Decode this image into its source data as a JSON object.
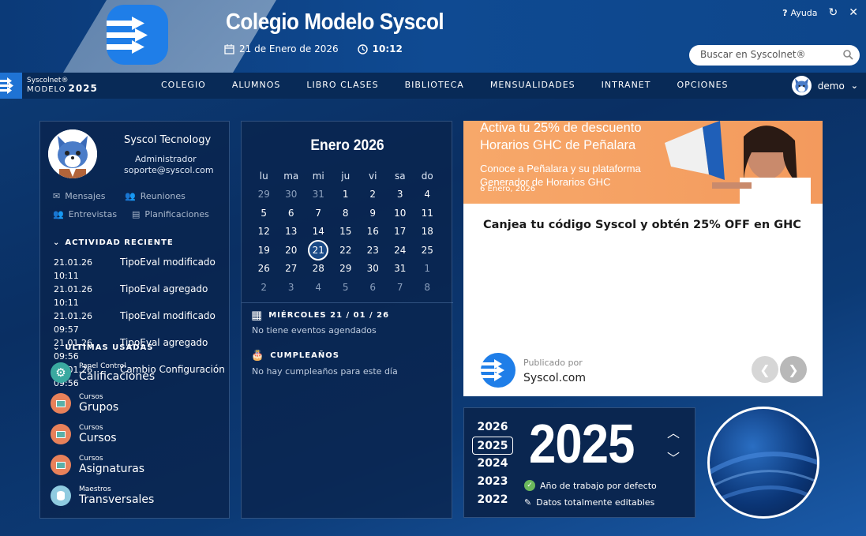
{
  "header": {
    "title": "Colegio Modelo Syscol",
    "date": "21 de Enero de 2026",
    "time": "10:12",
    "help_label": "Ayuda",
    "search_placeholder": "Buscar en Syscolnet®"
  },
  "navbar": {
    "brand": "Syscolnet®",
    "brand_model": "MODELO",
    "brand_year": "2025",
    "menu": [
      "COLEGIO",
      "ALUMNOS",
      "LIBRO CLASES",
      "BIBLIOTECA",
      "MENSUALIDADES",
      "INTRANET",
      "OPCIONES"
    ],
    "user": "demo"
  },
  "profile": {
    "name": "Syscol Tecnology",
    "role": "Administrador",
    "email": "soporte@syscol.com",
    "quick": [
      "Mensajes",
      "Reuniones",
      "Entrevistas",
      "Planificaciones"
    ]
  },
  "activity": {
    "title": "ACTIVIDAD RECIENTE",
    "items": [
      {
        "date": "21.01.26 10:11",
        "text": "TipoEval modificado"
      },
      {
        "date": "21.01.26 10:11",
        "text": "TipoEval agregado"
      },
      {
        "date": "21.01.26 09:57",
        "text": "TipoEval modificado"
      },
      {
        "date": "21.01.26 09:56",
        "text": "TipoEval agregado"
      },
      {
        "date": "21.01.26 09:56",
        "text": "Cambio Configuración"
      }
    ]
  },
  "recent": {
    "title": "ÚLTIMAS USADAS",
    "items": [
      {
        "cat": "Panel Control",
        "name": "Calificaciones",
        "color": "#3aa9a0"
      },
      {
        "cat": "Cursos",
        "name": "Grupos",
        "color": "#e8815a"
      },
      {
        "cat": "Cursos",
        "name": "Cursos",
        "color": "#e8815a"
      },
      {
        "cat": "Cursos",
        "name": "Asignaturas",
        "color": "#e8815a"
      },
      {
        "cat": "Maestros",
        "name": "Transversales",
        "color": "#8fcbe0"
      }
    ]
  },
  "calendar": {
    "title": "Enero 2026",
    "weekdays": [
      "lu",
      "ma",
      "mi",
      "ju",
      "vi",
      "sa",
      "do"
    ],
    "weeks": [
      [
        "29",
        "30",
        "31",
        "1",
        "2",
        "3",
        "4"
      ],
      [
        "5",
        "6",
        "7",
        "8",
        "9",
        "10",
        "11"
      ],
      [
        "12",
        "13",
        "14",
        "15",
        "16",
        "17",
        "18"
      ],
      [
        "19",
        "20",
        "21",
        "22",
        "23",
        "24",
        "25"
      ],
      [
        "26",
        "27",
        "28",
        "29",
        "30",
        "31",
        "1"
      ],
      [
        "2",
        "3",
        "4",
        "5",
        "6",
        "7",
        "8"
      ]
    ],
    "today": "21",
    "day_heading": "MIÉRCOLES 21 / 01 / 26",
    "day_events": "No tiene eventos agendados",
    "birthdays_heading": "CUMPLEAÑOS",
    "birthdays_text": "No hay cumpleaños para este día"
  },
  "news": {
    "banner_line1": "Activa tu 25% de descuento",
    "banner_line2": "Horarios GHC de Peñalara",
    "banner_line3": "Conoce a Peñalara y su plataforma",
    "banner_line4": "Generador de Horarios GHC",
    "banner_date": "6 Enero, 2026",
    "headline": "Canjea tu código Syscol y obtén 25% OFF en GHC",
    "published_by": "Publicado por",
    "publisher": "Syscol.com"
  },
  "year_panel": {
    "years": [
      "2026",
      "2025",
      "2024",
      "2023",
      "2022"
    ],
    "selected": "2025",
    "big": "2025",
    "feature1": "Año de trabajo por defecto",
    "feature2": "Datos totalmente editables"
  },
  "colors": {
    "accent": "#1f7ee8",
    "banner": "#f39a5d"
  }
}
